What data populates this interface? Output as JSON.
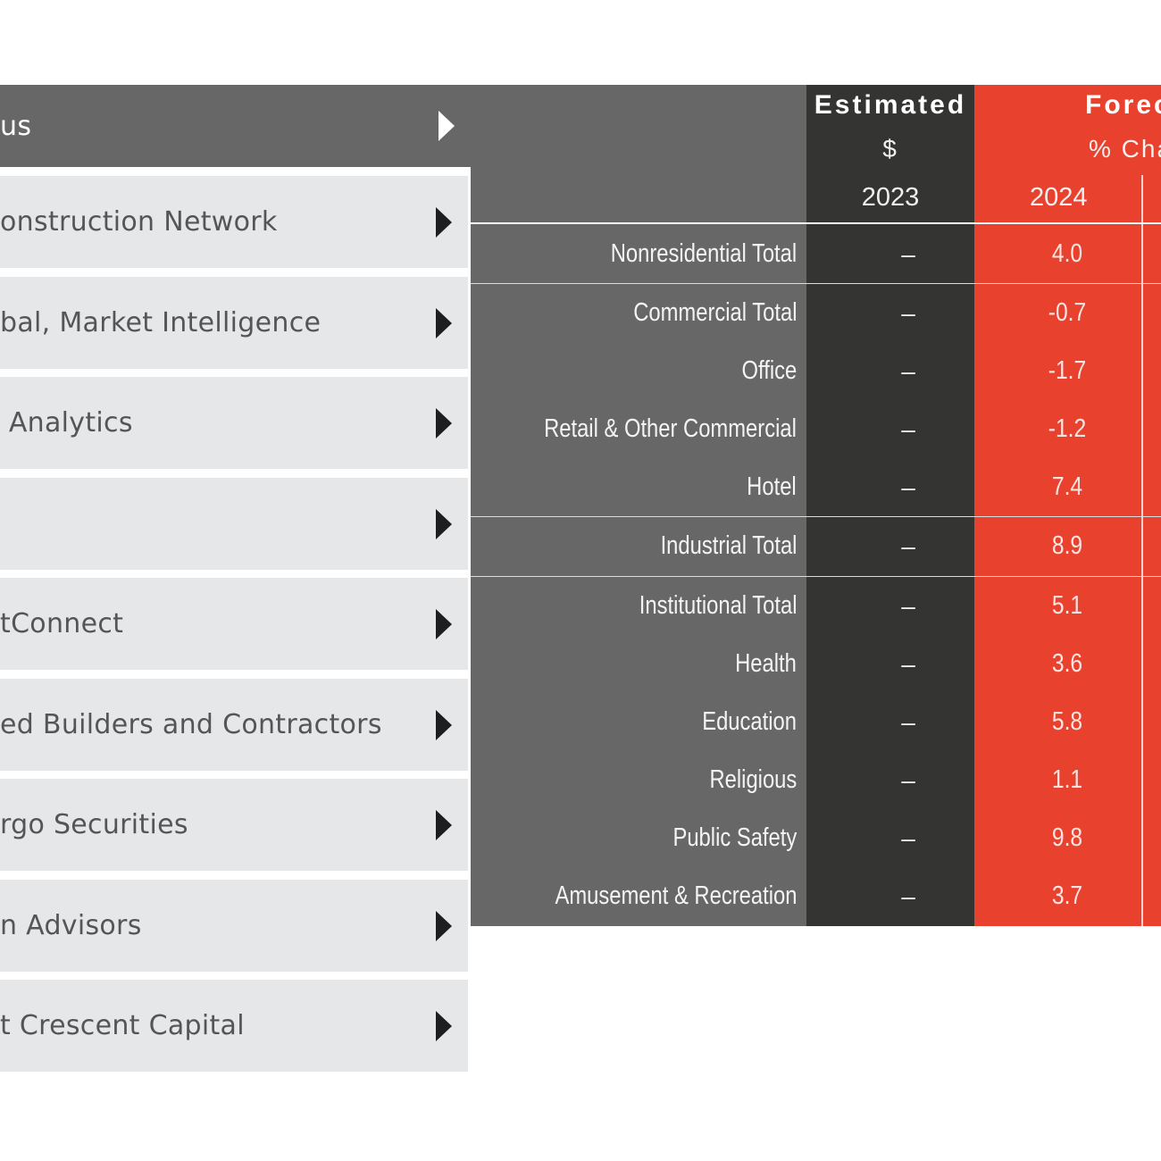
{
  "menu": {
    "items": [
      {
        "label": "us",
        "active": true
      },
      {
        "label": "onstruction Network",
        "active": false
      },
      {
        "label": "bal, Market Intelligence",
        "active": false
      },
      {
        "label": " Analytics",
        "active": false
      },
      {
        "label": "",
        "active": false
      },
      {
        "label": "tConnect",
        "active": false
      },
      {
        "label": "ed Builders and Contractors",
        "active": false
      },
      {
        "label": "rgo Securities",
        "active": false
      },
      {
        "label": "n Advisors",
        "active": false
      },
      {
        "label": "t Crescent Capital",
        "active": false
      }
    ],
    "arrow_icon": "triangle-right"
  },
  "table": {
    "header": {
      "estimated": {
        "title": "Estimated",
        "unit": "$",
        "year": "2023"
      },
      "forecast": {
        "title": "Foreca",
        "unit": "% Char",
        "year": "2024"
      }
    },
    "rows": [
      {
        "name": "Nonresidential Total",
        "est_2023": "–",
        "fc_2024": "4.0",
        "group_start": true
      },
      {
        "name": "Commercial Total",
        "est_2023": "–",
        "fc_2024": "-0.7",
        "group_start": true
      },
      {
        "name": "Office",
        "est_2023": "–",
        "fc_2024": "-1.7",
        "group_start": false
      },
      {
        "name": "Retail & Other Commercial",
        "est_2023": "–",
        "fc_2024": "-1.2",
        "group_start": false
      },
      {
        "name": "Hotel",
        "est_2023": "–",
        "fc_2024": "7.4",
        "group_start": false
      },
      {
        "name": "Industrial Total",
        "est_2023": "–",
        "fc_2024": "8.9",
        "group_start": true
      },
      {
        "name": "Institutional Total",
        "est_2023": "–",
        "fc_2024": "5.1",
        "group_start": true
      },
      {
        "name": "Health",
        "est_2023": "–",
        "fc_2024": "3.6",
        "group_start": false
      },
      {
        "name": "Education",
        "est_2023": "–",
        "fc_2024": "5.8",
        "group_start": false
      },
      {
        "name": "Religious",
        "est_2023": "–",
        "fc_2024": "1.1",
        "group_start": false
      },
      {
        "name": "Public Safety",
        "est_2023": "–",
        "fc_2024": "9.8",
        "group_start": false
      },
      {
        "name": "Amusement & Recreation",
        "est_2023": "–",
        "fc_2024": "3.7",
        "group_start": false
      }
    ]
  },
  "colors": {
    "menu_bg": "#e6e7e8",
    "menu_active_bg": "#666766",
    "label_col_bg": "#666766",
    "estimated_col_bg": "#343433",
    "forecast_col_bg": "#e8412e"
  }
}
